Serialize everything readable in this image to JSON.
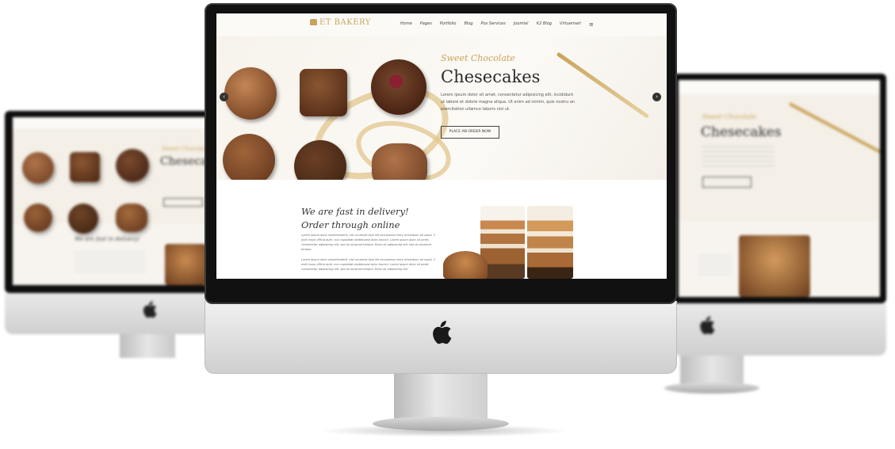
{
  "site": {
    "logo": "ET BAKERY",
    "nav": [
      "Home",
      "Pages",
      "Portfolio",
      "Blog",
      "Pos Services",
      "Joomla!",
      "K2 Blog",
      "Virtuemart"
    ]
  },
  "hero": {
    "subtitle": "Sweet Chocolate",
    "title": "Chesecakes",
    "text": "Lorem ipsum dolor sit amet, consectetur adipisicing elit, incididunt ut labore et dolore magna aliqua. Ut enim ad minim, quis nostru an exercitation ullamco laboris nisi ut.",
    "button": "PLACE AN ORDER NOW",
    "prev": "‹",
    "next": "›"
  },
  "section": {
    "heading_line1": "We are fast in delivery!",
    "heading_line2": "Order through online",
    "para1": "Lorem ipsum dolor reprehenderit, nisi occaecat high life accusamus terry richardson ad squid. 3 wolf moon officia aute, non cupidatat skateboard dolor brunch. Lorem ipsum dolor sit amet, consectetur adipisicing elit, sed do eiusmod tempor. Dolor sit adipisicing elit, sed do eiusmod tempor.",
    "para2": "Lorem ipsum dolor reprehenderit, nisi occaecat high life accusamus terry richardson ad squid. 3 wolf moon officia aute, non cupidatat skateboard dolor brunch. Lorem ipsum dolor sit amet, consectetur adipisicing elit, sed do eiusmod tempor. Dolor sit adipisicing elit."
  },
  "side_left": {
    "subtitle": "Sweet Chocolate",
    "title": "Chesecakes",
    "heading": "We are fast in delivery!"
  },
  "side_right": {
    "subtitle": "Sweet Chocolate",
    "title": "Chesecakes"
  },
  "colors": {
    "accent": "#c9a35b",
    "dark": "#2b2b2b",
    "bezel": "#111111"
  },
  "icons": [
    "apple-icon",
    "menu-icon",
    "arrow-left-icon",
    "arrow-right-icon",
    "logo-icon"
  ]
}
